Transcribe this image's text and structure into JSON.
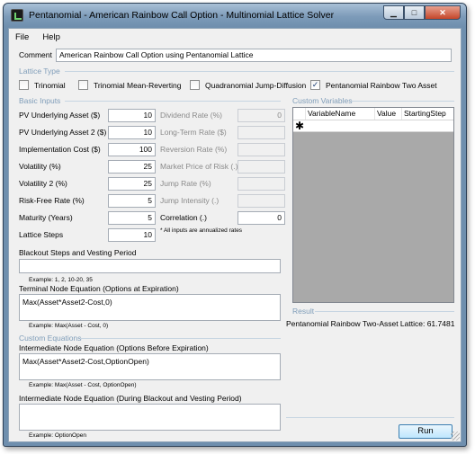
{
  "window": {
    "title": "Pentanomial - American Rainbow Call Option - Multinomial Lattice Solver",
    "minimize": "▁",
    "maximize": "□",
    "close": "✕"
  },
  "menu": [
    "File",
    "Help"
  ],
  "comment": {
    "label": "Comment",
    "value": "American Rainbow Call Option using Pentanomial Lattice"
  },
  "lattice_type": {
    "heading": "Lattice Type",
    "options": [
      {
        "label": "Trinomial",
        "checked": false
      },
      {
        "label": "Trinomial Mean-Reverting",
        "checked": false
      },
      {
        "label": "Quadranomial Jump-Diffusion",
        "checked": false
      },
      {
        "label": "Pentanomial Rainbow Two Asset",
        "checked": true
      }
    ]
  },
  "basic_inputs": {
    "heading": "Basic Inputs",
    "left": [
      {
        "label": "PV Underlying Asset ($)",
        "value": "10"
      },
      {
        "label": "PV Underlying Asset 2 ($)",
        "value": "10"
      },
      {
        "label": "Implementation Cost ($)",
        "value": "100"
      },
      {
        "label": "Volatility (%)",
        "value": "25"
      },
      {
        "label": "Volatility 2 (%)",
        "value": "25"
      },
      {
        "label": "Risk-Free Rate (%)",
        "value": "5"
      },
      {
        "label": "Maturity (Years)",
        "value": "5"
      },
      {
        "label": "Lattice Steps",
        "value": "10"
      }
    ],
    "right": [
      {
        "label": "Dividend Rate (%)",
        "value": "0",
        "enabled": false
      },
      {
        "label": "Long-Term Rate ($)",
        "value": "",
        "enabled": false
      },
      {
        "label": "Reversion Rate (%)",
        "value": "",
        "enabled": false
      },
      {
        "label": "Market Price of Risk (.)",
        "value": "",
        "enabled": false
      },
      {
        "label": "Jump Rate (%)",
        "value": "",
        "enabled": false
      },
      {
        "label": "Jump Intensity (.)",
        "value": "",
        "enabled": false
      },
      {
        "label": "Correlation (.)",
        "value": "0",
        "enabled": true
      }
    ],
    "annualized_note": "* All inputs are annualized rates"
  },
  "blackout": {
    "label": "Blackout Steps and Vesting Period",
    "value": "",
    "example": "Example: 1, 2, 10-20, 35"
  },
  "terminal": {
    "label": "Terminal Node Equation (Options at Expiration)",
    "value": "Max(Asset*Asset2-Cost,0)",
    "example": "Example: Max(Asset - Cost, 0)"
  },
  "custom_equations": {
    "heading": "Custom Equations",
    "intermediate": {
      "label": "Intermediate Node Equation (Options Before Expiration)",
      "value": "Max(Asset*Asset2-Cost,OptionOpen)",
      "example": "Example: Max(Asset - Cost, OptionOpen)"
    },
    "blackout_node": {
      "label": "Intermediate Node Equation (During Blackout and Vesting Period)",
      "value": "",
      "example": "Example: OptionOpen"
    }
  },
  "custom_variables": {
    "heading": "Custom Variables",
    "columns": [
      "VariableName",
      "Value",
      "StartingStep"
    ],
    "new_row_marker": "✱"
  },
  "result": {
    "heading": "Result",
    "text": "Pentanomial Rainbow Two-Asset Lattice: 61.7481"
  },
  "run_label": "Run"
}
